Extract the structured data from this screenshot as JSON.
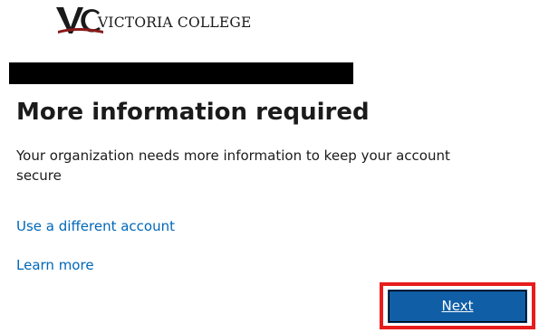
{
  "logo": {
    "text": "VICTORIA COLLEGE",
    "colors": {
      "mark_dark": "#1a1a1a",
      "mark_red": "#8b1a1a"
    }
  },
  "title": "More information required",
  "description": "Your organization needs more information to keep your account secure",
  "links": {
    "different_account": "Use a different account",
    "learn_more": "Learn more"
  },
  "next_button": {
    "label": "Next",
    "color": "#0f5ea6"
  },
  "colors": {
    "link": "#0067b8",
    "highlight": "#e81c1c",
    "text": "#1b1b1b"
  }
}
